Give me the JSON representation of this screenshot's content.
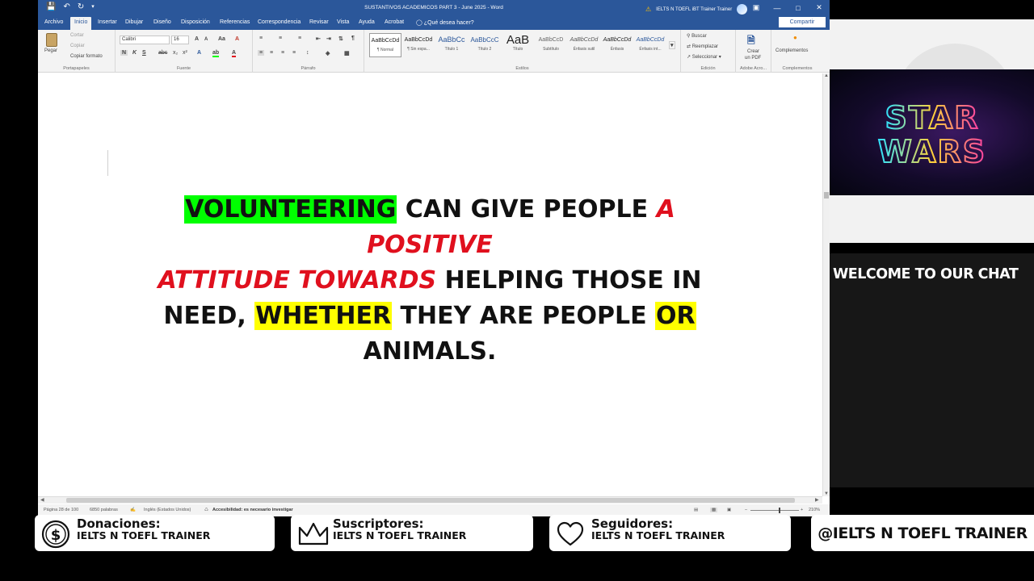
{
  "word": {
    "doc_title": "SUSTANTIVOS ACADEMICOS PART 3 - June 2025 - Word",
    "user_name": "IELTS N TOEFL iBT Trainer Trainer",
    "tabs": [
      "Archivo",
      "Inicio",
      "Insertar",
      "Dibujar",
      "Diseño",
      "Disposición",
      "Referencias",
      "Correspondencia",
      "Revisar",
      "Vista",
      "Ayuda",
      "Acrobat"
    ],
    "active_tab": "Inicio",
    "help_search": "¿Qué desea hacer?",
    "share_label": "Compartir",
    "ribbon": {
      "clipboard": {
        "paste": "Pegar",
        "cut": "Cortar",
        "copy": "Copiar",
        "format_painter": "Copiar formato",
        "label": "Portapapeles"
      },
      "font": {
        "name": "Calibri",
        "size": "16",
        "label": "Fuente"
      },
      "paragraph": {
        "label": "Párrafo"
      },
      "styles": {
        "label": "Estilos",
        "items": [
          {
            "preview": "AaBbCcDd",
            "name": "¶ Normal"
          },
          {
            "preview": "AaBbCcDd",
            "name": "¶ Sin espa..."
          },
          {
            "preview": "AaBbCc",
            "name": "Título 1"
          },
          {
            "preview": "AaBbCcC",
            "name": "Título 2"
          },
          {
            "preview": "AaB",
            "name": "Título"
          },
          {
            "preview": "AaBbCcD",
            "name": "Subtítulo"
          },
          {
            "preview": "AaBbCcDd",
            "name": "Énfasis sutil"
          },
          {
            "preview": "AaBbCcDd",
            "name": "Énfasis"
          },
          {
            "preview": "AaBbCcDd",
            "name": "Énfasis int..."
          }
        ]
      },
      "editing": {
        "find": "Buscar",
        "replace": "Reemplazar",
        "select": "Seleccionar",
        "label": "Edición"
      },
      "acrobat": {
        "create_pdf_1": "Crear",
        "create_pdf_2": "un PDF",
        "label": "Adobe Acro..."
      },
      "addins": {
        "button": "Complementos",
        "label": "Complementos"
      }
    },
    "document": {
      "line1_hl": "VOLUNTEERING",
      "line1_rest": " CAN GIVE PEOPLE ",
      "line1_red": "A POSITIVE",
      "line2_red": "ATTITUDE TOWARDS",
      "line2_rest": " HELPING THOSE IN",
      "line3_a": "NEED, ",
      "line3_hl1": "WHETHER",
      "line3_b": " THEY ARE PEOPLE ",
      "line3_hl2": "OR",
      "line3_c": " ANIMALS."
    },
    "status": {
      "page": "Página 28 de 100",
      "words": "6850 palabras",
      "language": "Inglés (Estados Unidos)",
      "accessibility": "Accesibilidad: es necesario investigar",
      "zoom": "210%"
    }
  },
  "stream": {
    "chat_title": "WELCOME TO OUR CHAT",
    "banner_line1": "STAR",
    "banner_line2": "WARS",
    "cards": [
      {
        "title": "Donaciones:",
        "subtitle": "IELTS N TOEFL TRAINER"
      },
      {
        "title": "Suscriptores:",
        "subtitle": "IELTS N TOEFL TRAINER"
      },
      {
        "title": "Seguidores:",
        "subtitle": "IELTS N TOEFL TRAINER"
      }
    ],
    "handle": "@IELTS N TOEFL TRAINER"
  },
  "colors": {
    "word_blue": "#2b579a",
    "highlight_green": "#00ff00",
    "highlight_yellow": "#ffff00",
    "emphasis_red": "#e0101e"
  }
}
